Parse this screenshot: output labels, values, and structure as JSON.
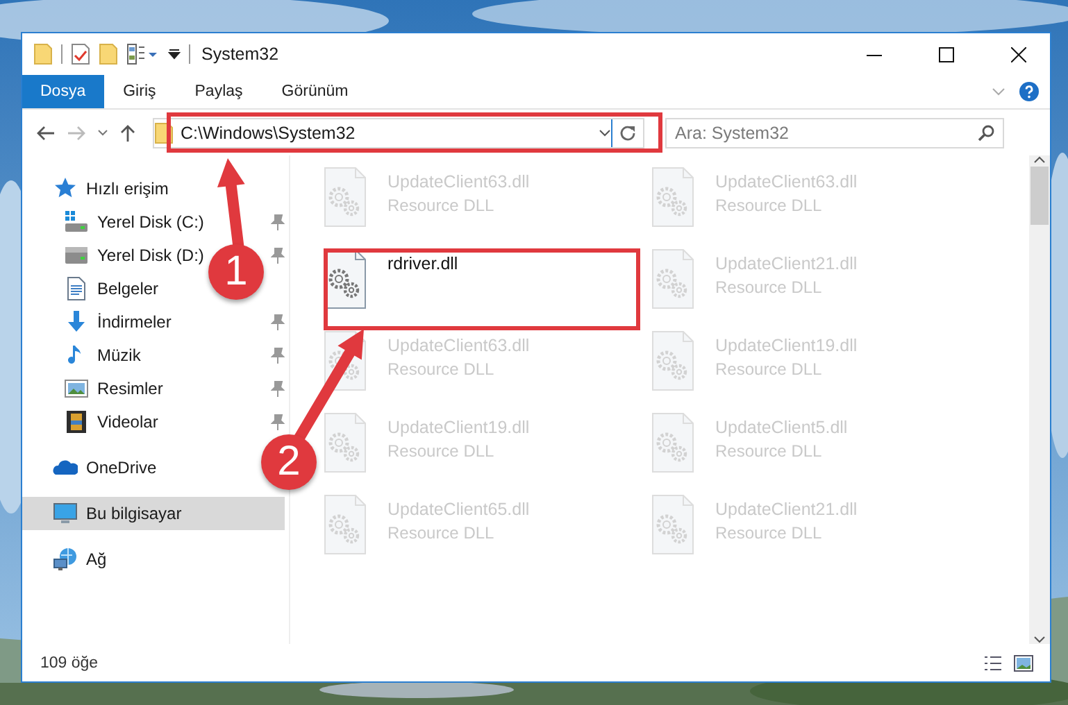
{
  "window": {
    "title": "System32"
  },
  "ribbon": {
    "tabs": [
      {
        "label": "Dosya",
        "selected": true
      },
      {
        "label": "Giriş",
        "selected": false
      },
      {
        "label": "Paylaş",
        "selected": false
      },
      {
        "label": "Görünüm",
        "selected": false
      }
    ]
  },
  "address_bar": {
    "path": "C:\\Windows\\System32"
  },
  "search": {
    "placeholder": "Ara: System32"
  },
  "sidebar": {
    "items": [
      {
        "label": "Hızlı erişim",
        "kind": "star",
        "selected": false,
        "children": [
          {
            "label": "Yerel Disk (C:)",
            "kind": "system-drive",
            "selected": false,
            "pinned": true
          },
          {
            "label": "Yerel Disk (D:)",
            "kind": "drive",
            "selected": false,
            "pinned": true
          },
          {
            "label": "Belgeler",
            "kind": "document",
            "selected": false,
            "pinned": false
          },
          {
            "label": "İndirmeler",
            "kind": "download",
            "selected": false,
            "pinned": true
          },
          {
            "label": "Müzik",
            "kind": "music",
            "selected": false,
            "pinned": true
          },
          {
            "label": "Resimler",
            "kind": "pictures",
            "selected": false,
            "pinned": true
          },
          {
            "label": "Videolar",
            "kind": "video",
            "selected": false,
            "pinned": true
          }
        ]
      },
      {
        "label": "OneDrive",
        "kind": "cloud",
        "selected": false
      },
      {
        "label": "Bu bilgisayar",
        "kind": "computer",
        "selected": true
      },
      {
        "label": "Ağ",
        "kind": "network",
        "selected": false
      }
    ]
  },
  "files": [
    {
      "name": "UpdateClient63.dll",
      "type": "Resource DLL",
      "faded": true
    },
    {
      "name": "UpdateClient63.dll",
      "type": "Resource DLL",
      "faded": true
    },
    {
      "name": "rdriver.dll",
      "faded": false
    },
    {
      "name": "UpdateClient21.dll",
      "type": "Resource DLL",
      "faded": true
    },
    {
      "name": "UpdateClient63.dll",
      "type": "Resource DLL",
      "faded": true
    },
    {
      "name": "UpdateClient19.dll",
      "type": "Resource DLL",
      "faded": true
    },
    {
      "name": "UpdateClient19.dll",
      "type": "Resource DLL",
      "faded": true
    },
    {
      "name": "UpdateClient5.dll",
      "type": "Resource DLL",
      "faded": true
    },
    {
      "name": "UpdateClient65.dll",
      "type": "Resource DLL",
      "faded": true
    },
    {
      "name": "UpdateClient21.dll",
      "type": "Resource DLL",
      "faded": true
    }
  ],
  "status_bar": {
    "item_count": "109 öğe"
  },
  "annotations": [
    {
      "number": "1"
    },
    {
      "number": "2"
    }
  ]
}
